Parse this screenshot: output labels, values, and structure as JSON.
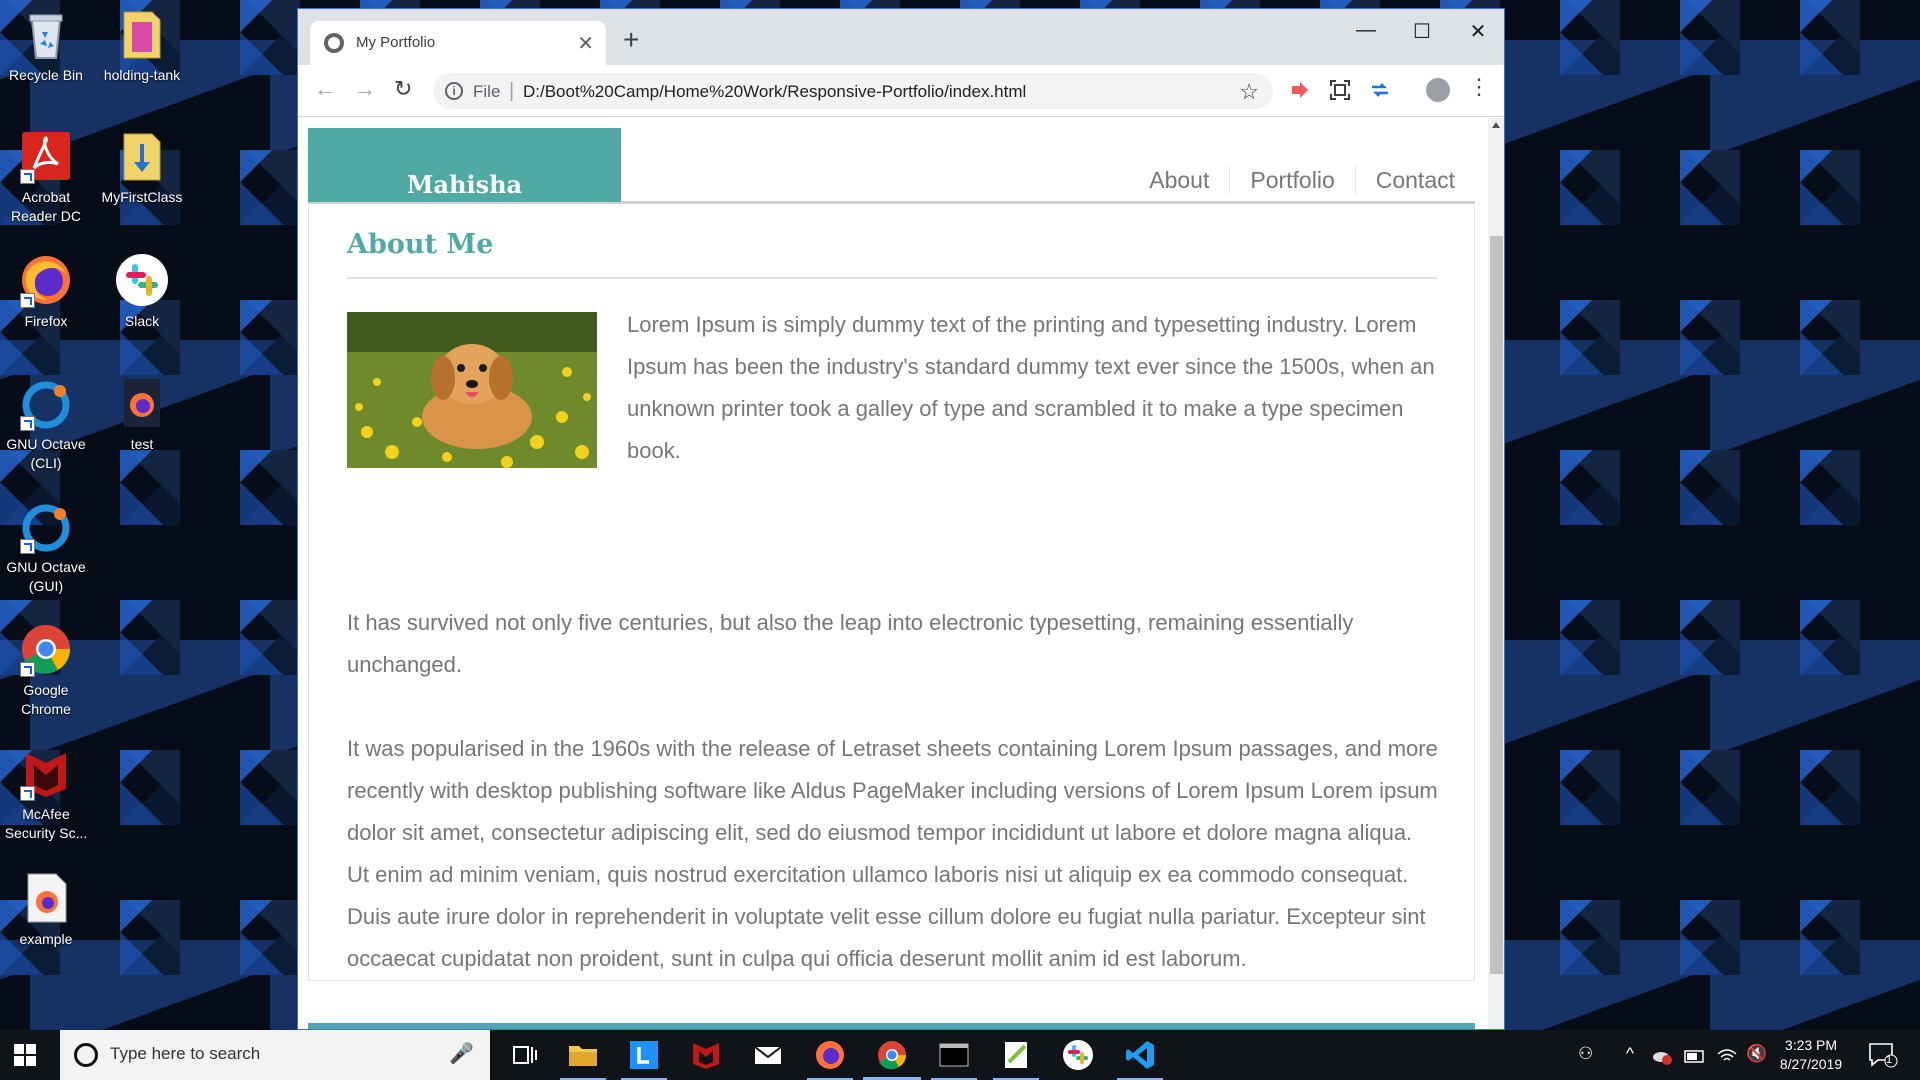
{
  "desktop": {
    "icons": [
      {
        "label": "Recycle Bin"
      },
      {
        "label": "holding-tank"
      },
      {
        "label": "Acrobat Reader DC"
      },
      {
        "label": "MyFirstClass"
      },
      {
        "label": "Firefox"
      },
      {
        "label": "Slack"
      },
      {
        "label": "GNU Octave (CLI)"
      },
      {
        "label": "test"
      },
      {
        "label": "GNU Octave (GUI)"
      },
      {
        "label": "Google Chrome"
      },
      {
        "label": "McAfee Security Sc..."
      },
      {
        "label": "example"
      }
    ]
  },
  "browser": {
    "tab_title": "My Portfolio",
    "tab_close": "✕",
    "new_tab": "+",
    "window_controls": {
      "minimize": "—",
      "maximize": "☐",
      "close": "✕"
    },
    "nav": {
      "back": "←",
      "forward": "→",
      "reload": "↻"
    },
    "address": {
      "info": "i",
      "scheme": "File",
      "separator": "|",
      "url": "D:/Boot%20Camp/Home%20Work/Responsive-Portfolio/index.html",
      "star": "☆"
    },
    "menu": "⋮"
  },
  "page": {
    "brand": "Mahisha",
    "nav_items": [
      "About",
      "Portfolio",
      "Contact"
    ],
    "section_title": "About Me",
    "paragraphs": [
      "Lorem Ipsum is simply dummy text of the printing and typesetting industry. Lorem Ipsum has been the industry's standard dummy text ever since the 1500s, when an unknown printer took a galley of type and scrambled it to make a type specimen book.",
      "It has survived not only five centuries, but also the leap into electronic typesetting, remaining essentially unchanged.",
      "It was popularised in the 1960s with the release of Letraset sheets containing Lorem Ipsum passages, and more recently with desktop publishing software like Aldus PageMaker including versions of Lorem Ipsum Lorem ipsum dolor sit amet, consectetur adipiscing elit, sed do eiusmod tempor incididunt ut labore et dolore magna aliqua. Ut enim ad minim veniam, quis nostrud exercitation ullamco laboris nisi ut aliquip ex ea commodo consequat. Duis aute irure dolor in reprehenderit in voluptate velit esse cillum dolore eu fugiat nulla pariatur. Excepteur sint occaecat cupidatat non proident, sunt in culpa qui officia deserunt mollit anim id est laborum."
    ],
    "accent_color": "#50aaa3",
    "text_color": "#777777"
  },
  "taskbar": {
    "search_placeholder": "Type here to search",
    "mic": "🎤",
    "time": "3:23 PM",
    "date": "8/27/2019",
    "tray": {
      "people": "⚇",
      "chevron": "^",
      "volume": "🔇",
      "notification": "1"
    }
  }
}
